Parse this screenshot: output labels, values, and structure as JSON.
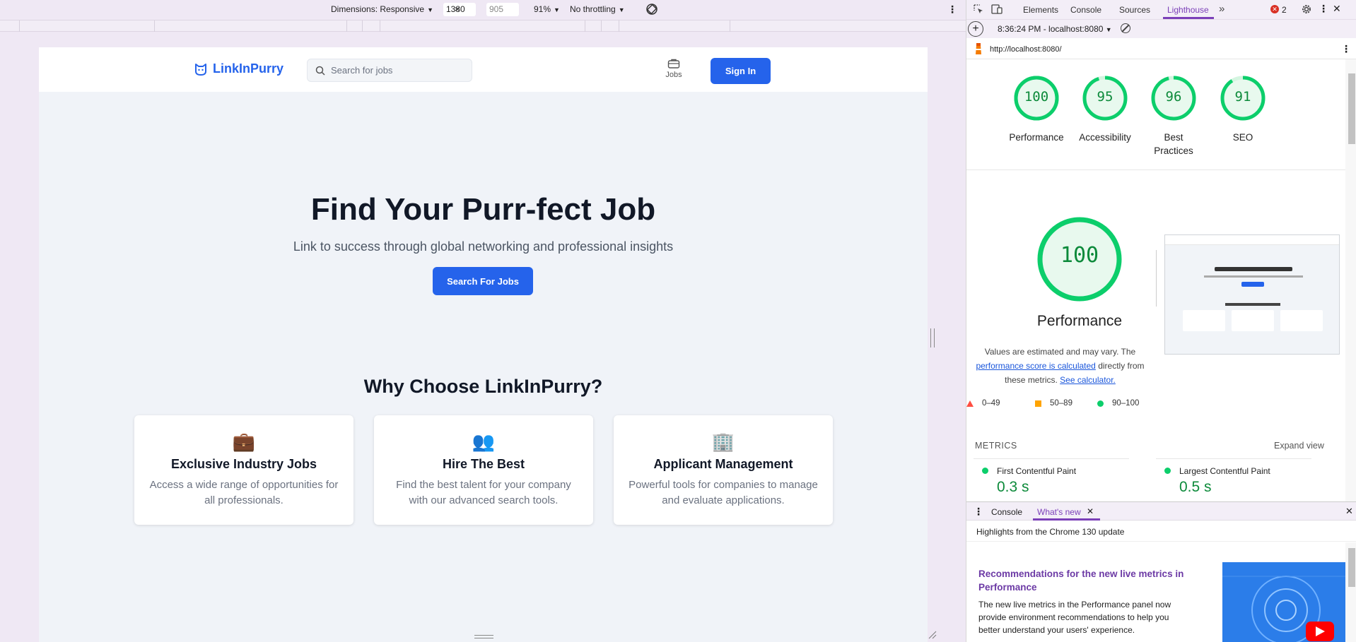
{
  "emulator": {
    "dimensions_label": "Dimensions: Responsive",
    "width_value": "1380",
    "height_value": "905",
    "times": "×",
    "zoom": "91%",
    "throttling": "No throttling"
  },
  "site": {
    "brand": "LinkInPurry",
    "search_placeholder": "Search for jobs",
    "nav_jobs": "Jobs",
    "signin_label": "Sign In",
    "hero_title": "Find Your Purr-fect Job",
    "hero_subtitle": "Link to success through global networking and professional insights",
    "hero_button": "Search For Jobs",
    "why_title": "Why Choose LinkInPurry?",
    "features": [
      {
        "emoji": "💼",
        "title": "Exclusive Industry Jobs",
        "desc": "Access a wide range of opportunities for all professionals."
      },
      {
        "emoji": "👥",
        "title": "Hire The Best",
        "desc": "Find the best talent for your company with our advanced search tools."
      },
      {
        "emoji": "🏢",
        "title": "Applicant Management",
        "desc": "Powerful tools for companies to manage and evaluate applications."
      }
    ]
  },
  "devtools": {
    "tabs": [
      "Elements",
      "Console",
      "Sources",
      "Lighthouse"
    ],
    "active_tab": "Lighthouse",
    "error_count": "2",
    "report_time": "8:36:24 PM - localhost:8080",
    "url": "http://localhost:8080/",
    "scores": [
      {
        "value": "100",
        "label": "Performance",
        "fraction": 1.0
      },
      {
        "value": "95",
        "label": "Accessibility",
        "fraction": 0.95
      },
      {
        "value": "96",
        "label": "Best Practices",
        "fraction": 0.96
      },
      {
        "value": "91",
        "label": "SEO",
        "fraction": 0.91
      }
    ],
    "big_score": "100",
    "big_label": "Performance",
    "note_pre": "Values are estimated and may vary. The ",
    "note_link1": "performance score is calculated",
    "note_mid": " directly from these metrics. ",
    "note_link2": "See calculator.",
    "legend": [
      "0–49",
      "50–89",
      "90–100"
    ],
    "metrics_heading": "METRICS",
    "expand_view": "Expand view",
    "metrics": [
      {
        "name": "First Contentful Paint",
        "value": "0.3 s"
      },
      {
        "name": "Largest Contentful Paint",
        "value": "0.5 s"
      }
    ],
    "drawer_tabs": [
      "Console",
      "What's new"
    ],
    "highlights": "Highlights from the Chrome 130 update",
    "whatsnew_title": "Recommendations for the new live metrics in Performance",
    "whatsnew_body": "The new live metrics in the Performance panel now provide environment recommendations to help you better understand your users' experience.",
    "colors": {
      "good": "#0cce6b",
      "average": "#ffa400",
      "poor": "#ff4e42",
      "accent": "#2563eb"
    }
  }
}
